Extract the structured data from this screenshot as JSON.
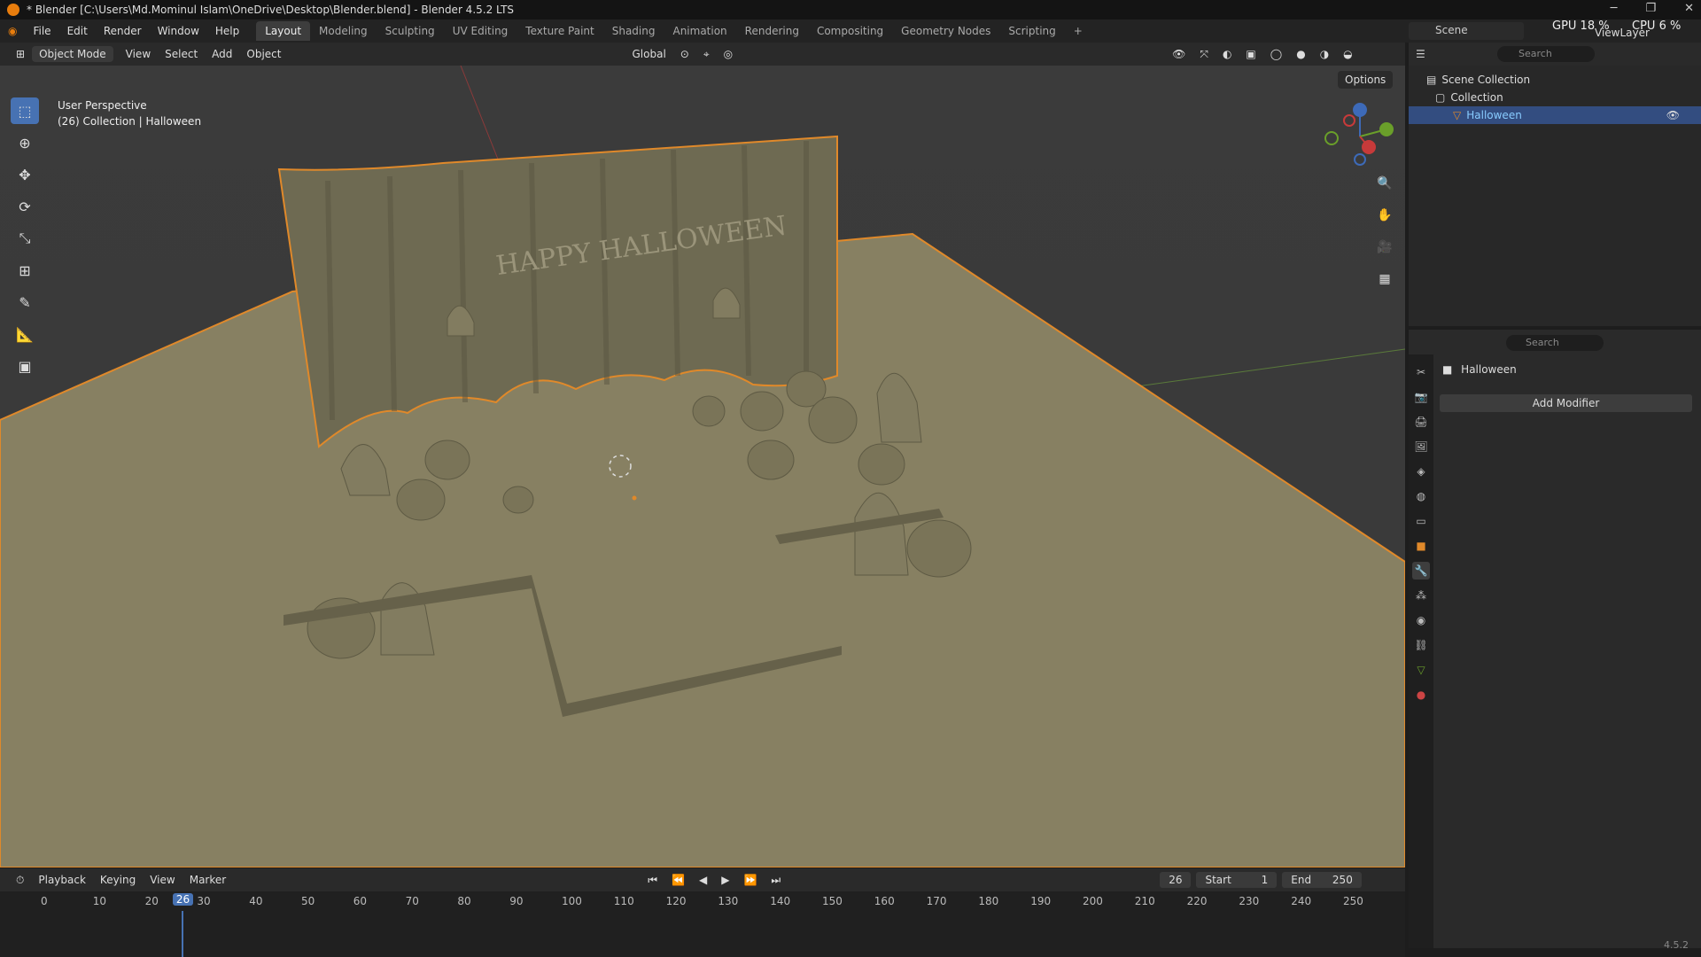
{
  "window": {
    "title": "* Blender [C:\\Users\\Md.Mominul Islam\\OneDrive\\Desktop\\Blender.blend] - Blender 4.5.2 LTS"
  },
  "menu": [
    "File",
    "Edit",
    "Render",
    "Window",
    "Help"
  ],
  "workspaces": [
    "Layout",
    "Modeling",
    "Sculpting",
    "UV Editing",
    "Texture Paint",
    "Shading",
    "Animation",
    "Rendering",
    "Compositing",
    "Geometry Nodes",
    "Scripting"
  ],
  "topright": {
    "scene": "Scene",
    "gpu": "GPU 18 %",
    "cpu": "CPU 6 %",
    "viewlayer": "ViewLayer"
  },
  "viewport": {
    "mode": "Object Mode",
    "menus": [
      "View",
      "Select",
      "Add",
      "Object"
    ],
    "transform": "Global",
    "perspective": "User Perspective",
    "collection_info": "(26) Collection | Halloween",
    "options": "Options",
    "scene_text": "HAPPY HALLOWEEN"
  },
  "outliner": {
    "search_placeholder": "Search",
    "scene_collection": "Scene Collection",
    "collection": "Collection",
    "object": "Halloween"
  },
  "properties": {
    "search_placeholder": "Search",
    "object_name": "Halloween",
    "add_modifier": "Add Modifier"
  },
  "timeline": {
    "menus": [
      "Playback",
      "Keying",
      "View",
      "Marker"
    ],
    "current_frame": "26",
    "start_label": "Start",
    "start": "1",
    "end_label": "End",
    "end": "250",
    "ticks": [
      "0",
      "10",
      "20",
      "30",
      "40",
      "50",
      "60",
      "70",
      "80",
      "90",
      "100",
      "110",
      "120",
      "130",
      "140",
      "150",
      "160",
      "170",
      "180",
      "190",
      "200",
      "210",
      "220",
      "230",
      "240",
      "250"
    ]
  },
  "version": "4.5.2"
}
